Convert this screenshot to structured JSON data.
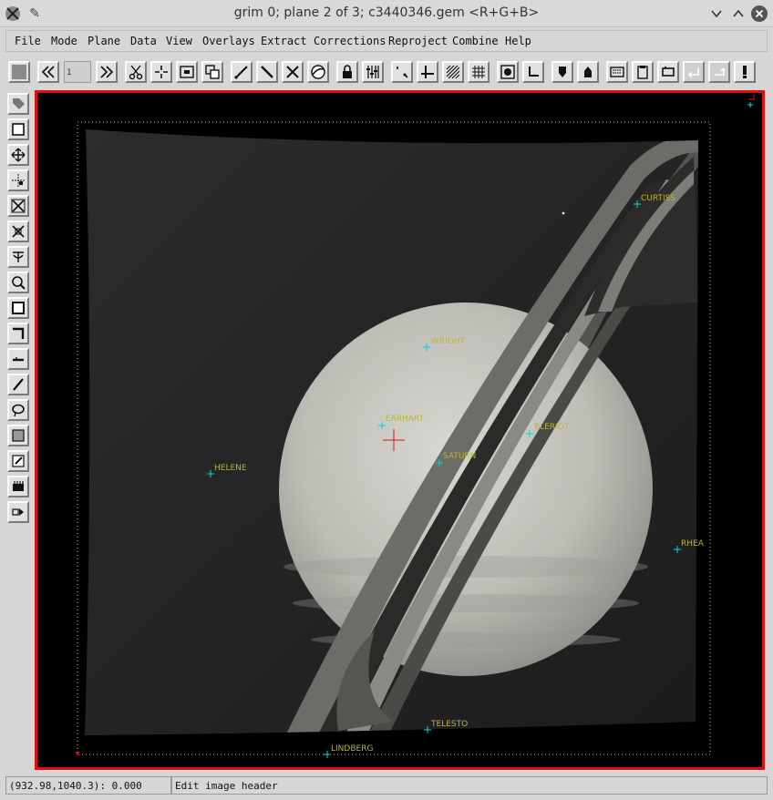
{
  "window": {
    "title": "grim 0;  plane 2 of 3;  c3440346.gem <R+G+B>",
    "controls": [
      "chevron-down-icon",
      "chevron-up-icon",
      "close-icon"
    ]
  },
  "menu": [
    "File",
    "Mode",
    "Plane",
    "Data",
    "View",
    "Overlays",
    "Extract",
    "Corrections",
    "Reproject",
    "Combine",
    "Help"
  ],
  "toolbar": {
    "plane_field": "1"
  },
  "viewer": {
    "border_color": "#e01010",
    "marker_color": "#00d8d8",
    "label_color": "#b7b53a",
    "labels": {
      "curtiss": "CURTISS",
      "wright": "WRIGHT",
      "earhart": "EARHART",
      "bleriot": "BLERIOT",
      "saturn": "SATURN",
      "helene": "HELENE",
      "rhea": "RHEA",
      "telesto": "TELESTO",
      "lindberg": "LINDBERG"
    }
  },
  "status": {
    "coords": "(932.98,1040.3): 0.000",
    "message": "Edit image header"
  }
}
